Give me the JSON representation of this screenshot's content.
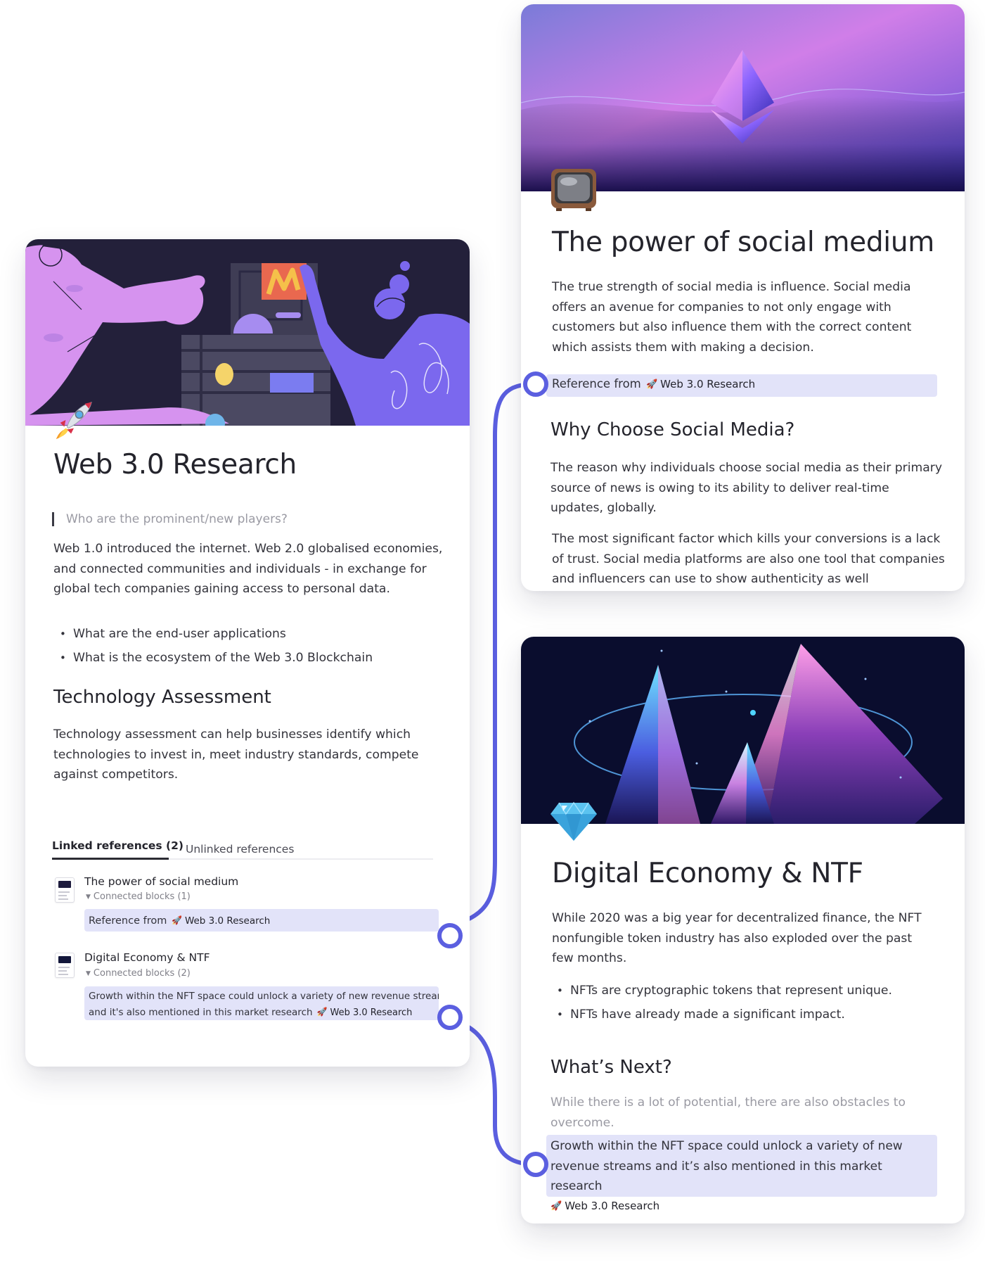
{
  "web3": {
    "title": "Web 3.0 Research",
    "quote": "Who are the prominent/new players?",
    "intro": "Web 1.0 introduced the internet. Web 2.0 globalised economies, and connected communities and individuals - in exchange for global tech companies gaining access to personal data.",
    "bullets": [
      "What are the end-user applications",
      "What is the ecosystem of the Web 3.0 Blockchain"
    ],
    "section_title": "Technology Assessment",
    "section_body": "Technology assessment can help businesses identify which technologies to invest in, meet industry standards, compete against competitors.",
    "tabs": {
      "linked": "Linked references (2)",
      "unlinked": "Unlinked references"
    },
    "refs": [
      {
        "title": "The power of social medium",
        "meta": "Connected blocks  (1)",
        "snippet_text": "Reference from",
        "snippet_chip": "Web 3.0 Research"
      },
      {
        "title": "Digital Economy & NTF",
        "meta": "Connected blocks  (2)",
        "snippet_line1": "Growth within the NFT space could unlock a variety of new revenue streams",
        "snippet_line2": "and it's also mentioned in this market research",
        "snippet_chip": "Web 3.0 Research"
      }
    ]
  },
  "social": {
    "title": "The power of social medium",
    "body": "The true strength of social media is influence. Social media offers an avenue for companies to not only engage with customers but also influence them with the correct content which assists them with making a decision.",
    "ref_text": "Reference from",
    "ref_chip": "Web 3.0 Research",
    "section_title": "Why Choose Social Media?",
    "section_p1": "The reason why individuals choose social media as their primary source of news is owing to its ability to deliver real-time updates, globally.",
    "section_p2": "The most significant factor which kills your conversions is a lack of trust. Social media platforms are also one tool that companies and influencers can use to show authenticity as well"
  },
  "digital": {
    "title": "Digital Economy & NTF",
    "body": "While 2020 was a big year for decentralized finance, the NFT nonfungible token industry has also exploded over the past few months.",
    "bullets": [
      "NFTs are cryptographic tokens that represent unique.",
      "NFTs have already made a significant impact."
    ],
    "section_title": "What’s Next?",
    "section_body": "While there is a lot of potential, there are also obstacles to overcome.",
    "highlight": "Growth within the NFT space could unlock a variety of new revenue streams and it’s also mentioned in this market research",
    "highlight_chip": "Web 3.0 Research"
  },
  "colors": {
    "accent": "#5b5fe0",
    "highlight_bg": "#e2e3f9",
    "text": "#2b2b33",
    "muted": "#9a9aa3"
  },
  "icons": {
    "web3_page_icon": "rocket-icon",
    "social_page_icon": "television-icon",
    "digital_page_icon": "gem-icon"
  }
}
